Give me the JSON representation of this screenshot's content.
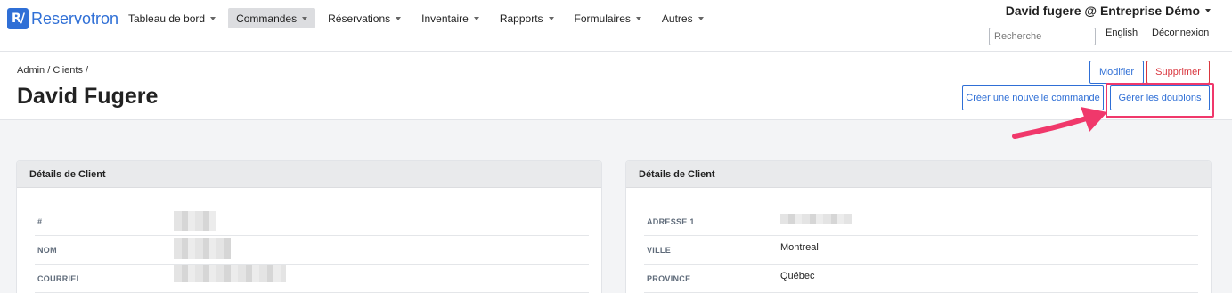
{
  "app": {
    "logo_mark": "R/",
    "brand": "Reservotron"
  },
  "nav": {
    "items": [
      {
        "label": "Tableau de bord",
        "active": false
      },
      {
        "label": "Commandes",
        "active": true
      },
      {
        "label": "Réservations",
        "active": false
      },
      {
        "label": "Inventaire",
        "active": false
      },
      {
        "label": "Rapports",
        "active": false
      },
      {
        "label": "Formulaires",
        "active": false
      },
      {
        "label": "Autres",
        "active": false
      }
    ],
    "user": "David fugere @ Entreprise Démo",
    "search_placeholder": "Recherche",
    "language": "English",
    "logout": "Déconnexion"
  },
  "header": {
    "breadcrumb": "Admin / Clients /",
    "title": "David Fugere",
    "buttons": {
      "edit": "Modifier",
      "delete": "Supprimer",
      "new_order": "Créer une nouvelle commande",
      "duplicates": "Gérer les doublons"
    }
  },
  "cards": {
    "left": {
      "title": "Détails de Client",
      "rows": [
        {
          "label": "#",
          "value": ""
        },
        {
          "label": "NOM",
          "value": ""
        },
        {
          "label": "COURRIEL",
          "value": ""
        }
      ]
    },
    "right": {
      "title": "Détails de Client",
      "rows": [
        {
          "label": "ADRESSE 1",
          "value": ""
        },
        {
          "label": "VILLE",
          "value": "Montreal"
        },
        {
          "label": "PROVINCE",
          "value": "Québec"
        }
      ]
    }
  },
  "colors": {
    "accent": "#2f6fd6",
    "danger": "#d9363e",
    "annotation": "#f0386b"
  }
}
